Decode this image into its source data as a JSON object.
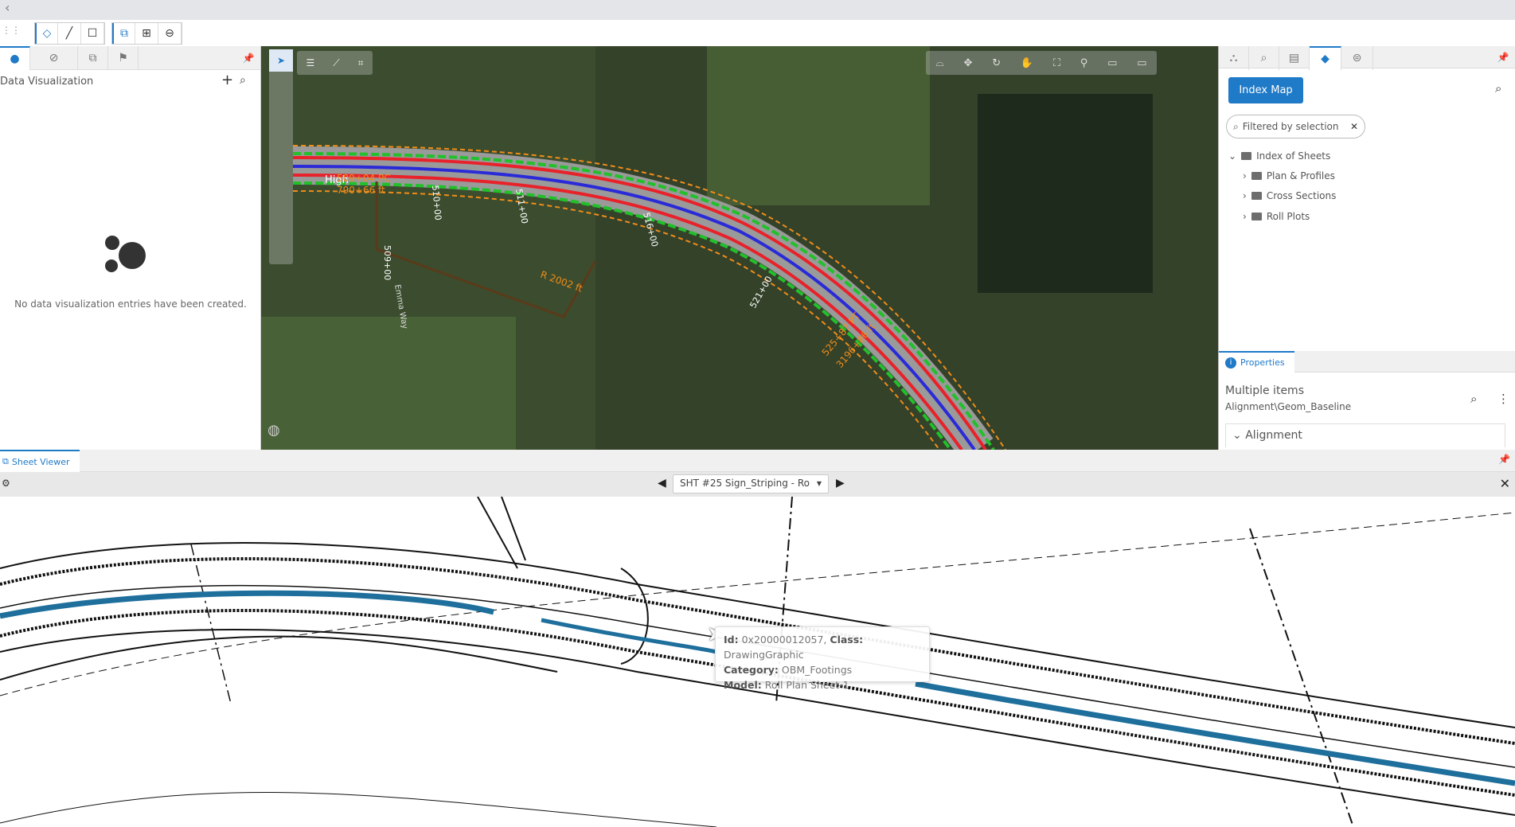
{
  "topbar": {
    "back_icon": "chevron-left-icon"
  },
  "toolbar": {
    "icons": [
      "grip-icon",
      "place-point-icon",
      "line-icon",
      "rectangle-icon",
      "select-elements-icon",
      "add-icon",
      "remove-icon"
    ]
  },
  "left_panel": {
    "tab_icons": [
      "data-viz-icon",
      "check-circle-icon",
      "layers-icon",
      "flag-icon"
    ],
    "title": "Data Visualization",
    "empty_message": "No data visualization entries have been created."
  },
  "map": {
    "labels": {
      "station1": "509+00",
      "station2": "510+00",
      "station3": "511+00",
      "station4": "516+00",
      "station5": "521+00",
      "road": "High",
      "curve1": "509+04 PC",
      "curve2": "790+66 ft",
      "radius": "R 2002 ft",
      "street": "Emma Way",
      "curve3": "525+87 PT",
      "curve4": "3196+86 ft"
    }
  },
  "right_panel": {
    "index_map_button": "Index Map",
    "filter_text": "Filtered by selection",
    "tree": {
      "root": "Index of Sheets",
      "children": [
        "Plan & Profiles",
        "Cross Sections",
        "Roll Plots"
      ]
    },
    "properties": {
      "tab_label": "Properties",
      "title": "Multiple items",
      "subtitle": "Alignment\\Geom_Baseline",
      "section": "Alignment"
    }
  },
  "sheet_viewer": {
    "tab_label": "Sheet Viewer",
    "selected_sheet": "SHT #25 Sign_Striping - Ro",
    "tooltip": {
      "id_label": "Id:",
      "id_value": "0x20000012057,",
      "class_label": "Class:",
      "class_value": "DrawingGraphic",
      "category_label": "Category:",
      "category_value": "OBM_Footings",
      "model_label": "Model:",
      "model_value": "Roll Plan Sheet-1"
    }
  },
  "colors": {
    "accent": "#1f7ac8",
    "road_red": "#e8212a",
    "road_blue": "#2a2ad8",
    "road_green": "#22c02a",
    "road_orange": "#f08c1a",
    "drawing_blue": "#1e6f9c"
  }
}
